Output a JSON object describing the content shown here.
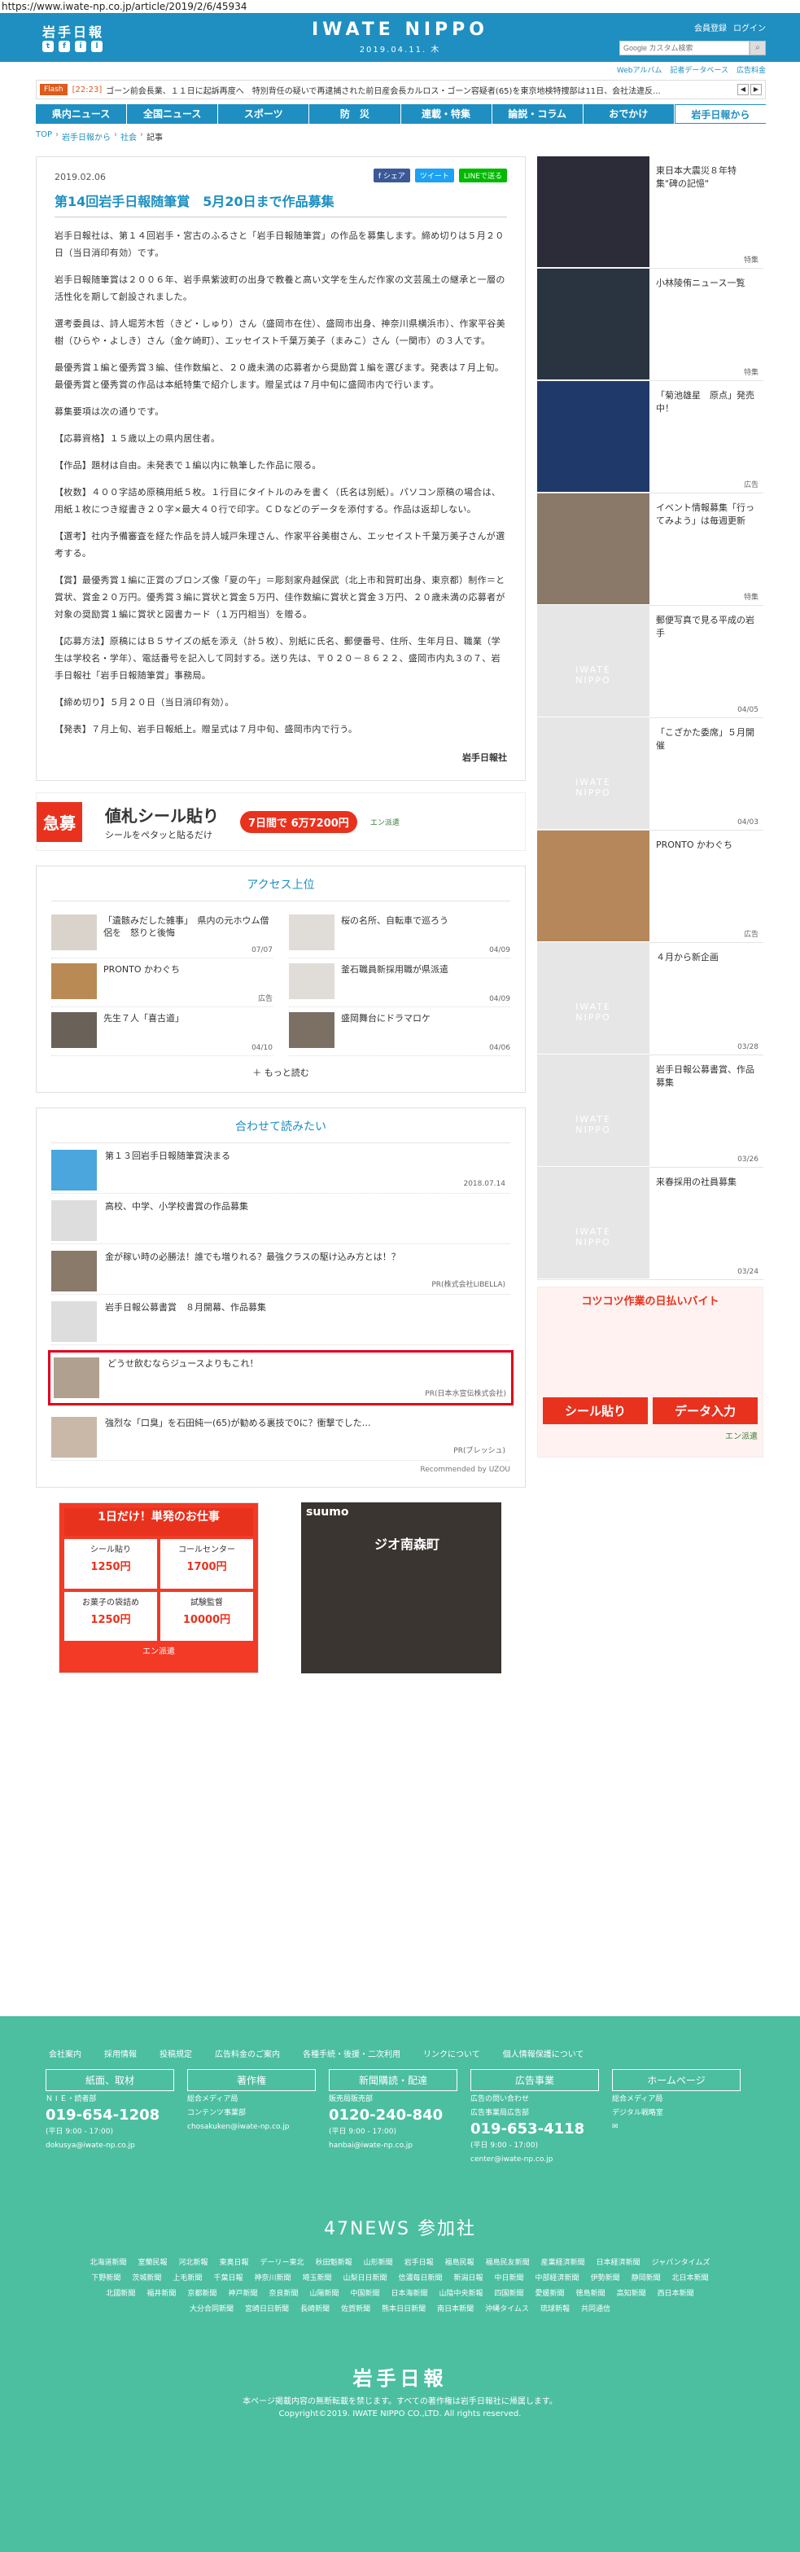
{
  "url": "https://www.iwate-np.co.jp/article/2019/2/6/45934",
  "header": {
    "logo": "岩手日報",
    "masthead": "IWATE NIPPO",
    "date": "2019.04.11. 木",
    "member": "会員登録",
    "login": "ログイン",
    "search_placeholder": "Google カスタム検索",
    "social": [
      "t",
      "f",
      "i",
      "l"
    ]
  },
  "subnav": [
    "Webアルバム",
    "記者データベース",
    "広告料金"
  ],
  "flash": {
    "tag": "Flash",
    "time": "[22:23]",
    "text": "ゴーン前会長業、１１日に起訴再度へ　特別背任の疑いで再逮捕された前日産会長カルロス・ゴーン容疑者(65)を東京地検特捜部は11日、会社法違反..."
  },
  "gnav": [
    "県内ニュース",
    "全国ニュース",
    "スポーツ",
    "防　災",
    "連載・特集",
    "論説・コラム",
    "おでかけ",
    "岩手日報から"
  ],
  "breadcrumb": [
    "TOP",
    "岩手日報から",
    "社会",
    "記事"
  ],
  "article": {
    "date": "2019.02.06",
    "share": [
      "f シェア",
      "ツイート",
      "LINEで送る"
    ],
    "title": "第14回岩手日報随筆賞　5月20日まで作品募集",
    "paras": [
      "岩手日報社は、第１４回岩手・宮古のふるさと「岩手日報随筆賞」の作品を募集します。締め切りは５月２０日（当日消印有効）です。",
      "岩手日報随筆賞は２００６年、岩手県紫波町の出身で教養と高い文学を生んだ作家の文芸風土の継承と一層の活性化を期して創設されました。",
      "選考委員は、詩人堀芳木哲（きど・しゅり）さん（盛岡市在住）、盛岡市出身、神奈川県横浜市）、作家平谷美樹（ひらや・よしき）さん（金ケ崎町）、エッセイスト千葉万美子（まみこ）さん（一関市）の３人です。",
      "最優秀賞１編と優秀賞３編、佳作数編と、２０歳未満の応募者から奨励賞１編を選びます。発表は７月上旬。最優秀賞と優秀賞の作品は本紙特集で紹介します。贈呈式は７月中旬に盛岡市内で行います。",
      "募集要項は次の通りです。",
      "【応募資格】１５歳以上の県内居住者。",
      "【作品】題材は自由。未発表で１編以内に執筆した作品に限る。",
      "【枚数】４００字詰め原稿用紙５枚。１行目にタイトルのみを書く（氏名は別紙）。パソコン原稿の場合は、用紙１枚につき縦書き２０字×最大４０行で印字。ＣＤなどのデータを添付する。作品は返却しない。",
      "【選考】社内予備審査を経た作品を詩人城戸朱理さん、作家平谷美樹さん、エッセイスト千葉万美子さんが選考する。",
      "【賞】最優秀賞１編に正賞のブロンズ像「夏の午」＝彫刻家舟越保武（北上市和賀町出身、東京都）制作＝と賞状、賞金２０万円。優秀賞３編に賞状と賞金５万円、佳作数編に賞状と賞金３万円、２０歳未満の応募者が対象の奨励賞１編に賞状と図書カード（１万円相当）を贈る。",
      "【応募方法】原稿にはＢ５サイズの紙を添え（計５枚）、別紙に氏名、郵便番号、住所、生年月日、職業（学生は学校名・学年）、電話番号を記入して同封する。送り先は、〒０２０－８６２２、盛岡市内丸３の７、岩手日報社「岩手日報随筆賞」事務局。",
      "【締め切り】５月２０日（当日消印有効）。",
      "【発表】７月上旬、岩手日報紙上。贈呈式は７月中旬、盛岡市内で行う。"
    ],
    "signature": "岩手日報社"
  },
  "ad_banner": {
    "tag": "急募",
    "title": "値札シール貼り",
    "sub": "シールをペタッと貼るだけ",
    "badge": "7日間で 6万7200円",
    "brand": "エン派遣"
  },
  "ranking": {
    "title": "アクセス上位",
    "items": [
      {
        "text": "「遺骸みだした雑事」　県内の元ホウム僧侶を　怒りと後悔",
        "date": "07/07"
      },
      {
        "text": "桜の名所、自転車で巡ろう",
        "date": "04/09"
      },
      {
        "text": "PRONTO かわぐち",
        "date": "広告"
      },
      {
        "text": "釜石職員新採用職が県派遣",
        "date": "04/09"
      },
      {
        "text": "先生７人「喜古道」",
        "date": "04/10"
      },
      {
        "text": "盛岡舞台にドラマロケ",
        "date": "04/06"
      }
    ],
    "more": "もっと読む"
  },
  "related": {
    "title": "合わせて読みたい",
    "items": [
      {
        "text": "第１３回岩手日報随筆賞決まる",
        "date": "2018.07.14"
      },
      {
        "text": "高校、中学、小学校書賞の作品募集",
        "date": ""
      },
      {
        "text": "金が稼い時の必勝法！誰でも増りれる？最強クラスの駆け込み方とは！？",
        "date": "PR(株式会社LIBELLA)"
      },
      {
        "text": "岩手日報公募書賞　８月開幕、作品募集",
        "date": ""
      },
      {
        "text": "どうせ飲むならジュースよりもこれ！",
        "date": "PR(日本水宣伝株式会社)"
      },
      {
        "text": "強烈な「口臭」を石田純一(65)が勧める裏技で0に？衝撃でした…",
        "date": "PR(ブレッシュ)"
      }
    ],
    "recommend": "Recommended by UZOU"
  },
  "ad_bottom_left": {
    "title": "1日だけ！単発のお仕事",
    "cells": [
      [
        "シール貼り",
        "1250円"
      ],
      [
        "コールセンター",
        "1700円"
      ],
      [
        "お菓子の袋詰め",
        "1250円"
      ],
      [
        "試験監督",
        "10000円"
      ]
    ],
    "brand": "エン派遣"
  },
  "ad_bottom_right": {
    "brand": "suumo",
    "name": "ジオ南森町"
  },
  "sidebar": [
    {
      "text": "東日本大震災８年特集\"碑の記憶\"",
      "date": "特集"
    },
    {
      "text": "小林陵侑ニュース一覧",
      "date": "特集"
    },
    {
      "text": "「菊池雄星　原点」発売中！",
      "date": "広告"
    },
    {
      "text": "イベント情報募集「行ってみよう」は毎週更新",
      "date": "特集"
    },
    {
      "text": "郵便写真で見る平成の岩手",
      "date": "04/05"
    },
    {
      "text": "「こざかた委席」５月開催",
      "date": "04/03"
    },
    {
      "text": "PRONTO かわぐち",
      "date": "広告"
    },
    {
      "text": "４月から新企画",
      "date": "03/28"
    },
    {
      "text": "岩手日報公募書賞、作品募集",
      "date": "03/26"
    },
    {
      "text": "来春採用の社員募集",
      "date": "03/24"
    }
  ],
  "side_ad": {
    "title": "コツコツ作業の日払いバイト",
    "b1": "シール貼り",
    "b2": "データ入力",
    "brand": "エン派遣"
  },
  "footer": {
    "links": [
      "会社案内",
      "採用情報",
      "投稿規定",
      "広告料金のご案内",
      "各種手続・後援・二次利用",
      "リンクについて",
      "個人情報保護について"
    ],
    "cols": [
      {
        "head": "紙面、取材",
        "lines": [
          "Ｎ I Ｅ・読者部"
        ],
        "phone": "019-654-1208",
        "hours": "(平日 9:00 - 17:00)",
        "mail": "dokusya@iwate-np.co.jp"
      },
      {
        "head": "著作権",
        "lines": [
          "総合メディア局",
          "コンテンツ事業部"
        ],
        "phone": "",
        "hours": "",
        "mail": "chosakuken@iwate-np.co.jp"
      },
      {
        "head": "新聞購読・配達",
        "lines": [
          "販売局販売部"
        ],
        "phone": "0120-240-840",
        "hours": "(平日 9:00 - 17:00)",
        "mail": "hanbai@iwate-np.co.jp"
      },
      {
        "head": "広告事業",
        "lines": [
          "広告の問い合わせ",
          "広告事業局広告部"
        ],
        "phone": "019-653-4118",
        "hours": "(平日 9:00 - 17:00)",
        "mail": "center@iwate-np.co.jp"
      },
      {
        "head": "ホームページ",
        "lines": [
          "総合メディア局",
          "デジタル戦略室"
        ],
        "phone": "",
        "hours": "",
        "mail": ""
      }
    ],
    "news_title": "47NEWS 参加社",
    "news_papers": [
      "北海道新聞",
      "室蘭民報",
      "河北新報",
      "東奥日報",
      "デーリー東北",
      "秋田魁新報",
      "山形新聞",
      "岩手日報",
      "福島民報",
      "福島民友新聞",
      "産業経済新聞",
      "日本経済新聞",
      "ジャパンタイムズ",
      "下野新聞",
      "茨城新聞",
      "上毛新聞",
      "千葉日報",
      "神奈川新聞",
      "埼玉新聞",
      "山梨日日新聞",
      "信濃毎日新聞",
      "新潟日報",
      "中日新聞",
      "中部経済新聞",
      "伊勢新聞",
      "静岡新聞",
      "北日本新聞",
      "北國新聞",
      "福井新聞",
      "京都新聞",
      "神戸新聞",
      "奈良新聞",
      "山陽新聞",
      "中国新聞",
      "日本海新聞",
      "山陰中央新報",
      "四国新聞",
      "愛媛新聞",
      "徳島新聞",
      "高知新聞",
      "西日本新聞",
      "大分合同新聞",
      "宮崎日日新聞",
      "長崎新聞",
      "佐賀新聞",
      "熊本日日新聞",
      "南日本新聞",
      "沖縄タイムス",
      "琉球新報",
      "共同通信"
    ],
    "logo": "岩手日報",
    "notice": "本ページ掲載内容の無断転載を禁じます。すべての著作権は岩手日報社に帰属します。",
    "copyright": "Copyright©2019. IWATE NIPPO CO.,LTD. All rights reserved."
  }
}
